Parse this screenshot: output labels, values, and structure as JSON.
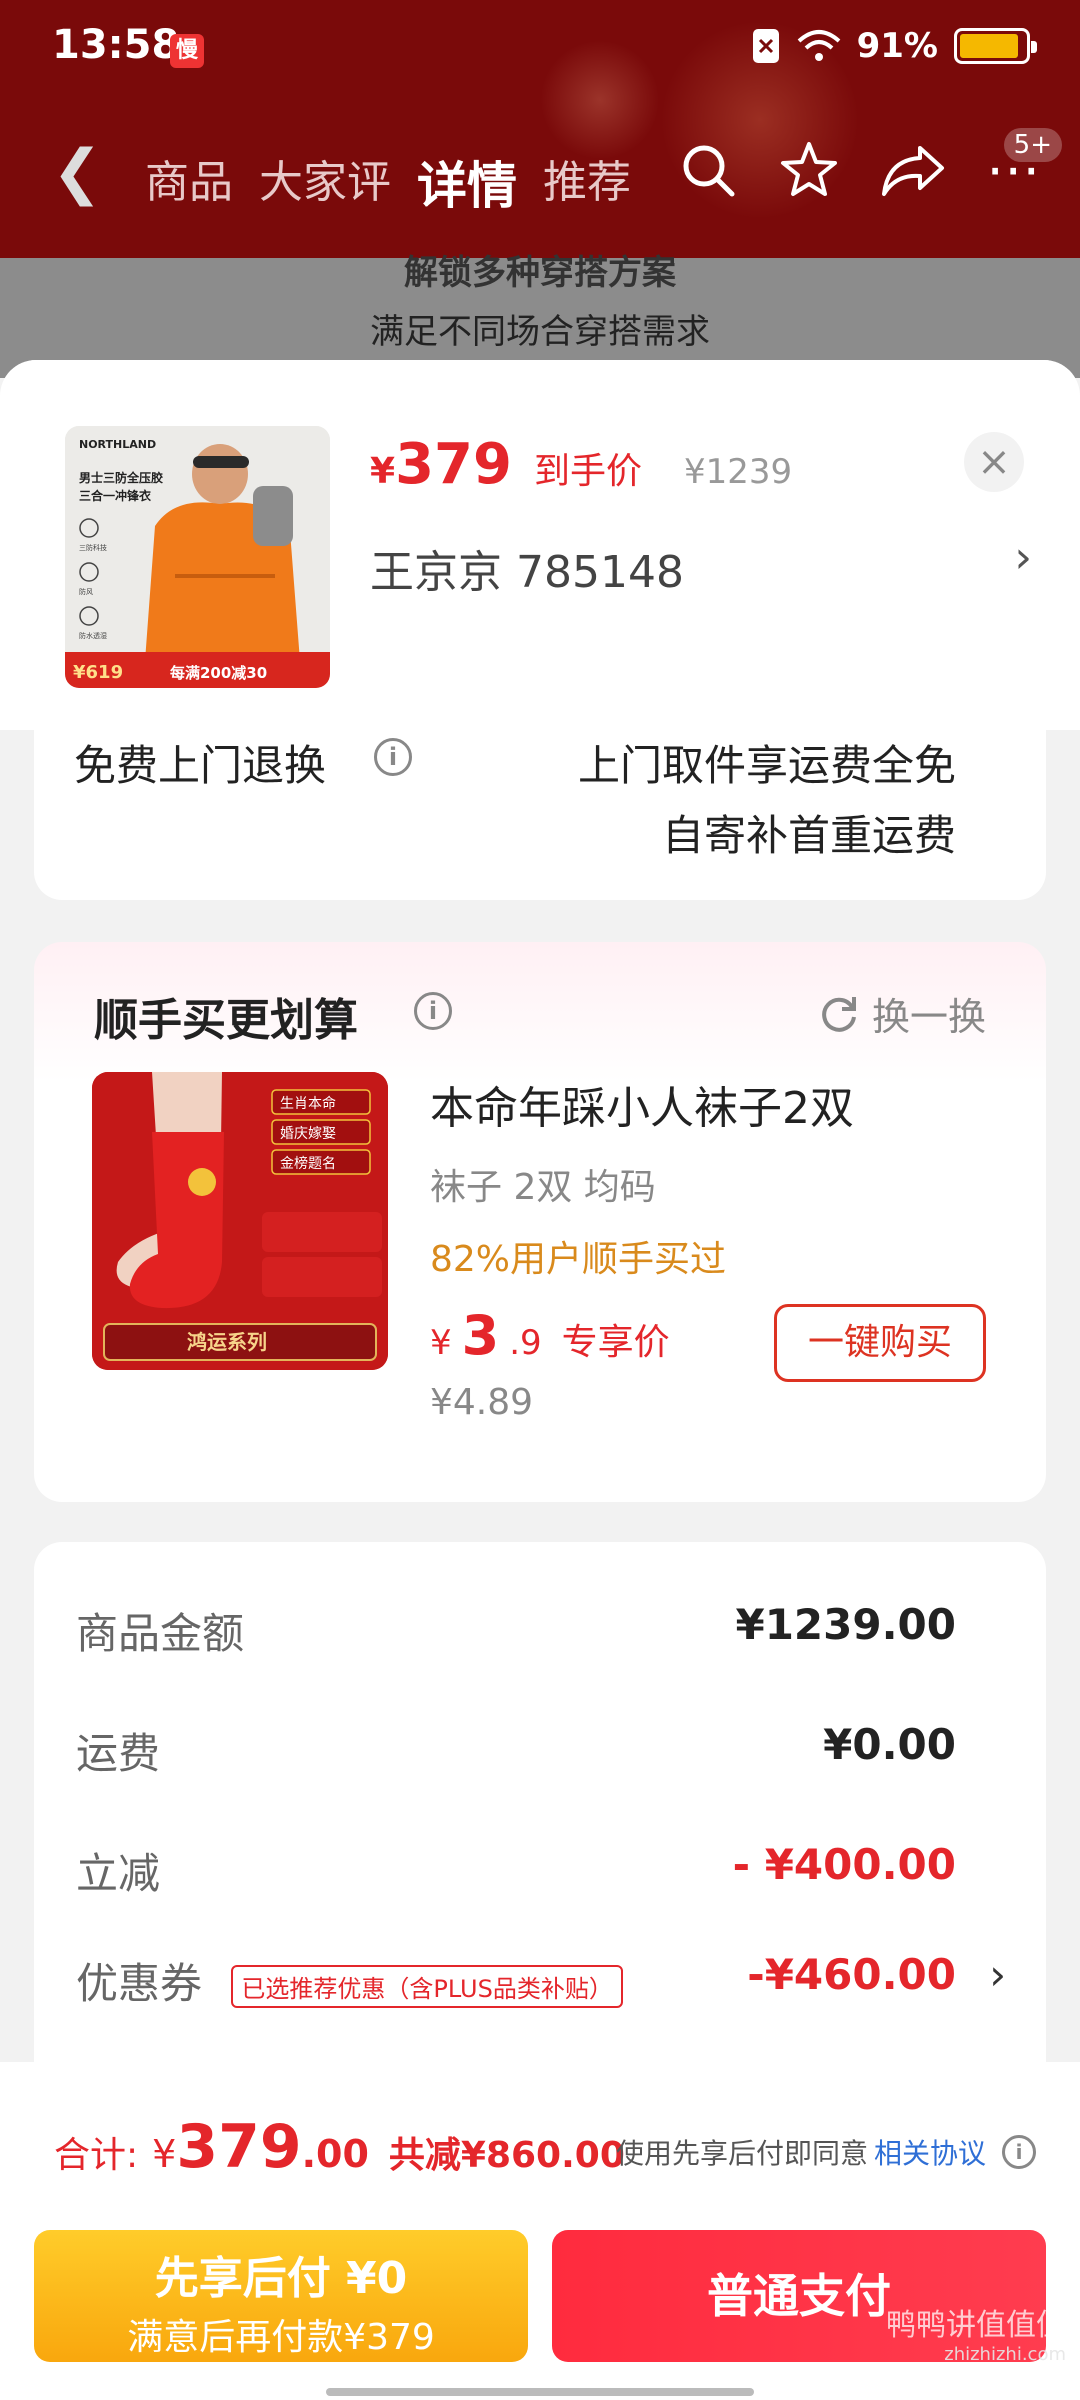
{
  "status_bar": {
    "time": "13:58",
    "app_badge": "慢",
    "battery_text": "91%",
    "battery_level": 0.91
  },
  "nav": {
    "tabs": [
      "商品",
      "大家评",
      "详情",
      "推荐"
    ],
    "active_tab": "详情",
    "more_badge": "5+"
  },
  "behind_text": {
    "line1": "解锁多种穿搭方案",
    "line2": "满足不同场合穿搭需求"
  },
  "product": {
    "price_symbol": "¥",
    "price": "379",
    "price_label": "到手价",
    "original_price": "¥1239",
    "address": "王京京  785148",
    "close_label": "×",
    "thumb": {
      "brand": "NORTHLAND",
      "title_line1": "男士三防全压胶",
      "title_line2": "三合一冲锋衣",
      "feature1": "三防科技",
      "feature2": "防风",
      "feature3": "防水透湿",
      "promo_price": "¥619",
      "promo_text": "每满200减30"
    }
  },
  "return_service": {
    "title": "免费上门退换",
    "line1": "上门取件享运费全免",
    "line2": "自寄补首重运费"
  },
  "upsell": {
    "title": "顺手买更划算",
    "swap_label": "换一换",
    "item_name": "本命年踩小人袜子2双",
    "spec": "袜子 2双   均码",
    "bought_text": "82%用户顺手买过",
    "price_symbol": "¥",
    "price_int": "3",
    "price_dec": ".9",
    "price_label": "专享价",
    "old_price": "¥4.89",
    "buy_label": "一键购买",
    "thumb": {
      "tag1": "生肖本命",
      "tag2": "婚庆嫁娶",
      "tag3": "金榜题名",
      "series": "鸿运系列"
    }
  },
  "summary": {
    "rows": [
      {
        "label": "商品金额",
        "value": "¥1239.00"
      },
      {
        "label": "运费",
        "value": "¥0.00"
      },
      {
        "label": "立减",
        "value": "- ¥400.00"
      },
      {
        "label": "优惠券",
        "tag": "已选推荐优惠（含PLUS品类补贴）",
        "value": "-¥460.00"
      }
    ]
  },
  "bottom": {
    "total_label": "合计:",
    "total_symbol": "¥",
    "total_int": "379",
    "total_dec": ".00",
    "saved_text": "共减¥860.00",
    "agree_text": "使用先享后付即同意",
    "agree_link": "相关协议",
    "later_title": "先享后付 ¥0",
    "later_sub": "满意后再付款¥379",
    "pay_label": "普通支付"
  },
  "watermark": {
    "text": "鸭鸭讲值值值",
    "site": "zhizhizhi.com"
  },
  "colors": {
    "header": "#7a0a0a",
    "accent_red": "#e4262b",
    "yellow": "#f9a70d",
    "link": "#2f6fd6"
  }
}
